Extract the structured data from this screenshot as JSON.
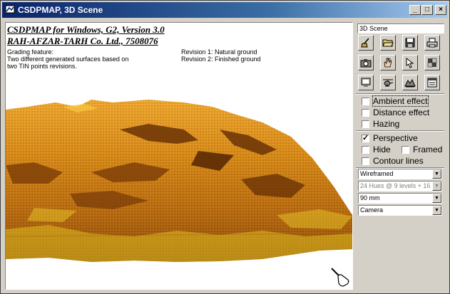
{
  "window": {
    "title": "CSDPMAP, 3D Scene",
    "controls": {
      "minimize": "_",
      "maximize": "□",
      "close": "×"
    }
  },
  "canvas": {
    "header_line1": "CSDPMAP for Windows, G2, Version 3.0",
    "header_line2": "RAH-AFZAR-TARH Co. Ltd., 7508076",
    "notes": {
      "grading_label": "Grading feature:",
      "grading_line1": "Two different generated surfaces based on",
      "grading_line2": " two TIN points revisions.",
      "revision1": "Revision 1: Natural ground",
      "revision2": "Revision 2: Finished ground"
    },
    "colors": {
      "terrain_light": "#f5b030",
      "terrain_mid": "#d08010",
      "terrain_dark": "#7a3c08",
      "terrain_yellow": "#e8d020"
    },
    "cursor_icon": "hand-pointer-icon"
  },
  "panel": {
    "scene_name": "3D Scene",
    "tools": [
      {
        "icon": "broom-icon"
      },
      {
        "icon": "open-folder-icon"
      },
      {
        "icon": "save-disk-icon"
      },
      {
        "icon": "printer-icon"
      },
      {
        "icon": "camera-icon"
      },
      {
        "icon": "hand-icon"
      },
      {
        "icon": "pointer-icon"
      },
      {
        "icon": "puzzle-icon"
      },
      {
        "icon": "monitor-icon"
      },
      {
        "icon": "helicopter-icon"
      },
      {
        "icon": "terrain-icon"
      },
      {
        "icon": "window-icon"
      }
    ],
    "effects": {
      "ambient": {
        "label": "Ambient effect",
        "checked": false
      },
      "distance": {
        "label": "Distance effect",
        "checked": false
      },
      "hazing": {
        "label": "Hazing",
        "checked": false
      }
    },
    "view": {
      "perspective": {
        "label": "Perspective",
        "checked": true
      },
      "hide": {
        "label": "Hide",
        "checked": false
      },
      "framed": {
        "label": "Framed",
        "checked": false
      },
      "contour": {
        "label": "Contour lines",
        "checked": false
      }
    },
    "selects": {
      "render_mode": "Wireframed",
      "hues": "24 Hues @ 9 levels + 16",
      "focal_length": "90 mm",
      "view_mode": "Camera"
    }
  }
}
